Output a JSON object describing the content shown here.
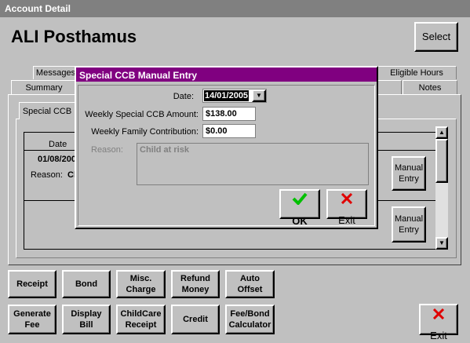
{
  "window": {
    "title": "Account Detail"
  },
  "header": {
    "client_name": "ALI Posthamus",
    "select_label": "Select"
  },
  "tabs_row1": [
    "Messages",
    "Eligible Hours"
  ],
  "tabs_row2": [
    "Summary",
    "Notes"
  ],
  "subtab": {
    "label": "Special CCB"
  },
  "grid": {
    "col_date": "Date",
    "row1_date": "01/08/200",
    "row1_reason_label": "Reason:",
    "row1_reason_value": "Cl",
    "manual_entry_label": "Manual\nEntry"
  },
  "dialog": {
    "title": "Special CCB Manual Entry",
    "date_label": "Date:",
    "date_value": "14/01/2005",
    "amount_label": "Weekly Special CCB Amount:",
    "amount_value": "$138.00",
    "family_label": "Weekly Family Contribution:",
    "family_value": "$0.00",
    "reason_label": "Reason:",
    "reason_value": "Child at risk",
    "ok_label": "OK",
    "exit_label": "Exit",
    "ok_icon": "check-icon",
    "exit_icon": "x-icon"
  },
  "actions_row1": [
    "Receipt",
    "Bond",
    "Misc.\nCharge",
    "Refund\nMoney",
    "Auto\nOffset"
  ],
  "actions_row2": [
    "Generate\nFee",
    "Display\nBill",
    "ChildCare\nReceipt",
    "Credit",
    "Fee/Bond\nCalculator"
  ],
  "main_exit_label": "Exit",
  "colors": {
    "dialog_title_bg": "#800080",
    "check_green": "#00c000",
    "x_red": "#e00000"
  }
}
